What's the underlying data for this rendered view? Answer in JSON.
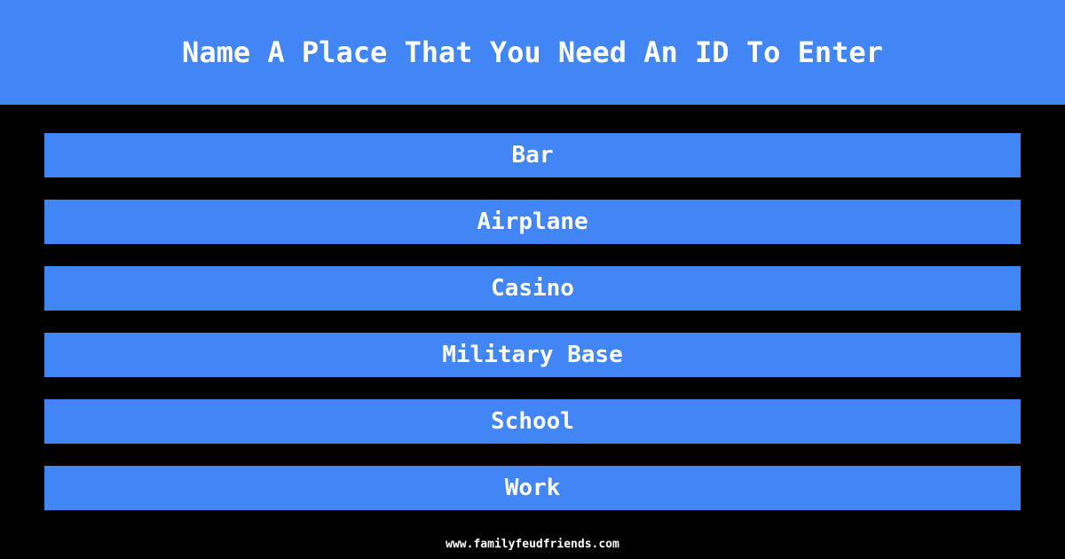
{
  "theme": {
    "background_color": "#000000",
    "accent_color": "#4285f4",
    "text_color": "#ffffff"
  },
  "header": {
    "title": "Name A Place That You Need An ID To Enter"
  },
  "answers": [
    {
      "label": "Bar"
    },
    {
      "label": "Airplane"
    },
    {
      "label": "Casino"
    },
    {
      "label": "Military Base"
    },
    {
      "label": "School"
    },
    {
      "label": "Work"
    }
  ],
  "footer": {
    "url": "www.familyfeudfriends.com"
  }
}
